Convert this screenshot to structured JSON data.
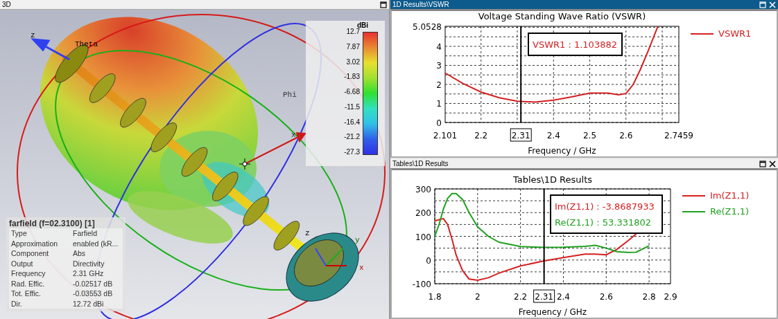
{
  "scene3d": {
    "title": "3D",
    "active": false,
    "axis_labels": [
      "z",
      "Theta",
      "Phi",
      "x",
      "z",
      "y",
      "x"
    ],
    "colorbar": {
      "unit": "dBi",
      "ticks": [
        "12.7",
        "7.87",
        "3.02",
        "-1.83",
        "-6.68",
        "-11.5",
        "-16.4",
        "-21.2",
        "-27.3"
      ]
    },
    "info": {
      "title": "farfield (f=02.3100) [1]",
      "rows": [
        {
          "label": "Type",
          "value": "Farfield"
        },
        {
          "label": "Approximation",
          "value": "enabled (kR..."
        },
        {
          "label": "Component",
          "value": "Abs"
        },
        {
          "label": "Output",
          "value": "Directivity"
        },
        {
          "label": "Frequency",
          "value": "2.31 GHz"
        },
        {
          "label": "Rad. Effic.",
          "value": "-0.02517 dB"
        },
        {
          "label": "Tot. Effic.",
          "value": "-0.03553 dB"
        },
        {
          "label": "Dir.",
          "value": "12.72 dBi"
        }
      ]
    }
  },
  "vswr_panel": {
    "title": "1D Results\\VSWR",
    "active": true,
    "chart_data": {
      "type": "line",
      "title": "Voltage Standing Wave Ratio (VSWR)",
      "xlabel": "Frequency / GHz",
      "x": [
        2.101,
        2.15,
        2.2,
        2.25,
        2.3,
        2.35,
        2.4,
        2.45,
        2.5,
        2.55,
        2.58,
        2.6,
        2.62,
        2.64,
        2.66,
        2.688
      ],
      "series": [
        {
          "name": "VSWR1",
          "color": "#d42020",
          "values": [
            2.6,
            2.05,
            1.6,
            1.3,
            1.12,
            1.07,
            1.17,
            1.35,
            1.55,
            1.55,
            1.45,
            1.52,
            2.0,
            2.8,
            3.7,
            5.05
          ]
        }
      ],
      "xlim": [
        2.101,
        2.7459
      ],
      "ylim": [
        0,
        5.0528
      ],
      "xticks": [
        2.101,
        2.2,
        2.4,
        2.5,
        2.6,
        2.7459
      ],
      "yticks": [
        0,
        1,
        2,
        3,
        4,
        {
          "value": 5.0528,
          "label": "5.0528"
        }
      ],
      "grid": true,
      "legend": true,
      "ref_lines": [
        {
          "axis": "x",
          "value": 2.31,
          "label": "2.31"
        }
      ],
      "annotations": [
        {
          "text": "VSWR1 : 1.103882"
        }
      ]
    }
  },
  "impedance_panel": {
    "title": "Tables\\1D Results",
    "active": false,
    "chart_data": {
      "type": "line",
      "title": "Tables\\1D Results",
      "xlabel": "Frequency / GHz",
      "x": [
        1.8,
        1.82,
        1.84,
        1.86,
        1.88,
        1.9,
        1.93,
        1.96,
        2.0,
        2.05,
        2.1,
        2.2,
        2.31,
        2.4,
        2.5,
        2.55,
        2.6,
        2.65,
        2.7,
        2.74,
        2.8
      ],
      "series": [
        {
          "name": "Im(Z1,1)",
          "color": "#d42020",
          "values": [
            165,
            170,
            175,
            150,
            90,
            20,
            -45,
            -80,
            -85,
            -75,
            -55,
            -25,
            -4,
            10,
            25,
            25,
            22,
            45,
            80,
            110,
            null
          ]
        },
        {
          "name": "Re(Z1,1)",
          "color": "#1ea01e",
          "values": [
            100,
            150,
            215,
            260,
            280,
            280,
            255,
            200,
            140,
            100,
            75,
            57,
            53,
            54,
            58,
            62,
            50,
            35,
            32,
            33,
            60
          ]
        }
      ],
      "xlim": [
        1.8,
        2.9
      ],
      "ylim": [
        -100,
        300
      ],
      "xticks": [
        1.8,
        2,
        2.2,
        2.4,
        2.6,
        2.8,
        2.9
      ],
      "yticks": [
        -100,
        0,
        100,
        200,
        300
      ],
      "grid": true,
      "legend": true,
      "ref_lines": [
        {
          "axis": "x",
          "value": 2.31,
          "label": "2.31"
        }
      ],
      "annotations": [
        {
          "text": "Im(Z1,1) : -3.8687933"
        },
        {
          "text": "Re(Z1,1) : 53.331802"
        }
      ]
    }
  }
}
